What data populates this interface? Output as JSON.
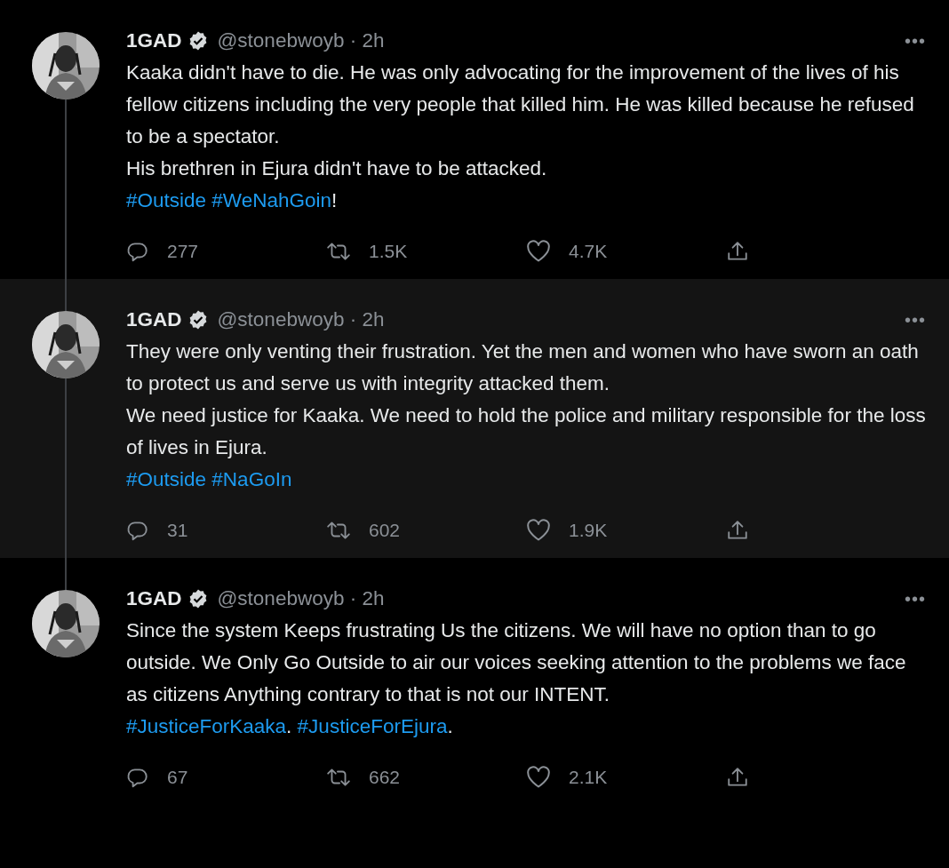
{
  "tweets": [
    {
      "highlighted": false,
      "thread_above": false,
      "thread_below": true,
      "name": "1GAD",
      "verified": true,
      "meta": "@stonebwoyb · 2h",
      "more": "•••",
      "paragraphs": [
        "Kaaka didn't have to die. He was only advocating for the improvement of the lives of his fellow citizens including the very people that killed him. He was killed because he refused to be a spectator.",
        "His brethren in Ejura didn't have to be attacked."
      ],
      "tags": [
        {
          "kind": "hashtag",
          "text": "#Outside"
        },
        {
          "kind": "hashtag",
          "text": "#WeNahGoin"
        },
        {
          "kind": "plain",
          "text": "!"
        }
      ],
      "replies": "277",
      "retweets": "1.5K",
      "likes": "4.7K"
    },
    {
      "highlighted": true,
      "thread_above": true,
      "thread_below": true,
      "name": "1GAD",
      "verified": true,
      "meta": "@stonebwoyb · 2h",
      "more": "•••",
      "paragraphs": [
        "They were only venting their frustration. Yet the men and women who have sworn an oath to protect us and serve us with integrity attacked them.",
        "We need justice for Kaaka. We need to hold the police and military responsible for the loss of lives in Ejura."
      ],
      "tags": [
        {
          "kind": "hashtag",
          "text": "#Outside"
        },
        {
          "kind": "hashtag",
          "text": "#NaGoIn"
        }
      ],
      "replies": "31",
      "retweets": "602",
      "likes": "1.9K"
    },
    {
      "highlighted": false,
      "thread_above": true,
      "thread_below": false,
      "name": "1GAD",
      "verified": true,
      "meta": "@stonebwoyb · 2h",
      "more": "•••",
      "paragraphs": [
        "Since the system Keeps frustrating Us the citizens. We will have no option than to go outside. We Only Go Outside to air our voices seeking attention to the problems we face as citizens Anything contrary to that is not our INTENT."
      ],
      "tags": [
        {
          "kind": "hashtag",
          "text": "#JusticeForKaaka"
        },
        {
          "kind": "plain",
          "text": ". "
        },
        {
          "kind": "hashtag",
          "text": "#JusticeForEjura"
        },
        {
          "kind": "plain",
          "text": "."
        }
      ],
      "replies": "67",
      "retweets": "662",
      "likes": "2.1K"
    }
  ]
}
